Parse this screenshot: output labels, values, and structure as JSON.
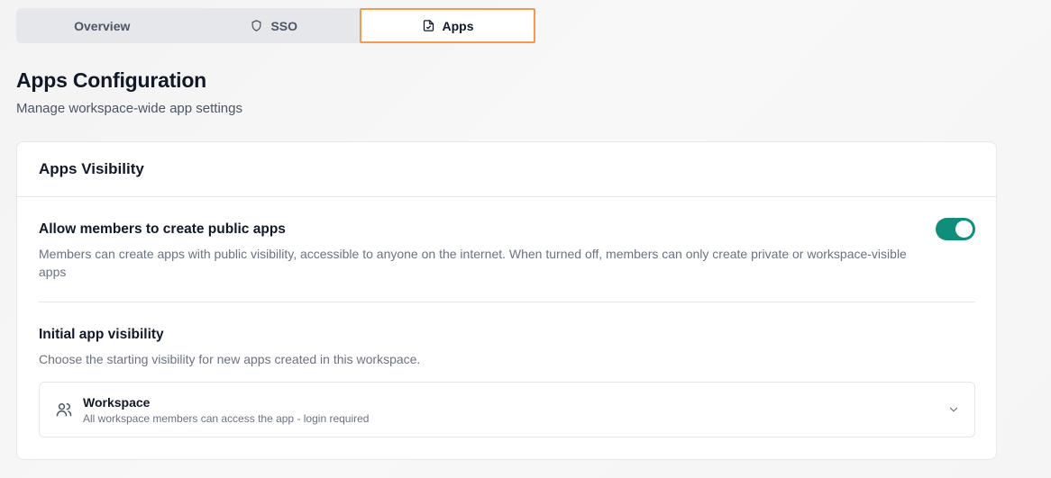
{
  "tabs": {
    "overview": "Overview",
    "sso": "SSO",
    "apps": "Apps"
  },
  "header": {
    "title": "Apps Configuration",
    "subtitle": "Manage workspace-wide app settings"
  },
  "card": {
    "title": "Apps Visibility",
    "public_apps": {
      "title": "Allow members to create public apps",
      "description": "Members can create apps with public visibility, accessible to anyone on the internet. When turned off, members can only create private or workspace-visible apps",
      "enabled": true
    },
    "initial_visibility": {
      "title": "Initial app visibility",
      "description": "Choose the starting visibility for new apps created in this workspace.",
      "selected": {
        "label": "Workspace",
        "description": "All workspace members can access the app - login required",
        "icon": "users-icon"
      }
    }
  },
  "colors": {
    "accent": "#0f8f7a",
    "active_tab_border": "#f59a4b"
  }
}
